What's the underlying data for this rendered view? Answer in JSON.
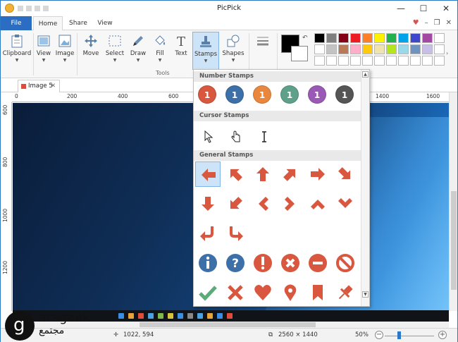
{
  "app": {
    "title": "PicPick"
  },
  "window_controls": {
    "minimize": "—",
    "maximize": "☐",
    "close": "✕"
  },
  "menu": {
    "file": "File",
    "tabs": [
      "Home",
      "Share",
      "View"
    ],
    "right_icons": [
      "heart-icon",
      "minimize-ribbon-icon",
      "restore-icon",
      "close-icon"
    ]
  },
  "ribbon": {
    "buttons": [
      {
        "label": "Clipboard"
      },
      {
        "label": "View"
      },
      {
        "label": "Image"
      },
      {
        "label": "Move"
      },
      {
        "label": "Select"
      },
      {
        "label": "Draw"
      },
      {
        "label": "Fill"
      },
      {
        "label": "Text"
      },
      {
        "label": "Stamps"
      },
      {
        "label": "Shapes"
      }
    ],
    "group_tools": "Tools",
    "primary_color": "#000000",
    "secondary_color": "#ffffff",
    "palette": [
      "#000000",
      "#7f7f7f",
      "#880015",
      "#ed1c24",
      "#ff7f27",
      "#fff200",
      "#22b14c",
      "#00a2e8",
      "#3f48cc",
      "#a349a4",
      "#ffffff",
      "#ffffff",
      "#c3c3c3",
      "#b97a57",
      "#ffaec9",
      "#ffc90e",
      "#efe4b0",
      "#b5e61d",
      "#99d9ea",
      "#7092be",
      "#c8bfe7",
      "#ffffff",
      "#ffffff",
      "#ffffff",
      "#ffffff",
      "#ffffff",
      "#ffffff",
      "#ffffff",
      "#ffffff",
      "#ffffff",
      "#ffffff",
      "#ffffff",
      "#ffffff"
    ]
  },
  "document_tab": {
    "label": "Image 5",
    "close": "✕"
  },
  "ruler": {
    "h_labels": [
      "0",
      "200",
      "400",
      "600",
      "1400",
      "1600"
    ],
    "v_labels": [
      "600",
      "800",
      "1000",
      "1200"
    ]
  },
  "stamps_menu": {
    "sections": {
      "number": "Number Stamps",
      "cursor": "Cursor Stamps",
      "general": "General Stamps"
    },
    "number_stamps": [
      {
        "label": "1",
        "color": "#d9573f"
      },
      {
        "label": "1",
        "color": "#3d6fa8"
      },
      {
        "label": "1",
        "color": "#e8873d"
      },
      {
        "label": "1",
        "color": "#5fa08a"
      },
      {
        "label": "1",
        "color": "#9b59b6"
      },
      {
        "label": "1",
        "color": "#555555"
      }
    ],
    "stamp_color": "#d9573f",
    "info_color": "#3d6fa8",
    "check_color": "#5aab78"
  },
  "status": {
    "cursor_pos": "1022, 594",
    "image_size": "2560 × 1440",
    "zoom": "50%",
    "zoom_out": "−",
    "zoom_in": "+"
  },
  "watermark": {
    "brand_en": "arageek",
    "brand_ar": "مجتمع",
    "mark": "g"
  }
}
